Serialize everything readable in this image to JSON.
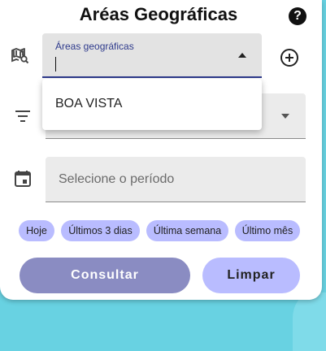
{
  "title": "Aréas Geográficas",
  "icons": {
    "help": "help-circle-icon",
    "map_search": "map-search-icon",
    "filter": "filter-icon",
    "calendar": "calendar-icon",
    "add": "add-circle-icon"
  },
  "areas_field": {
    "label": "Áreas geográficas",
    "value": ""
  },
  "dropdown": {
    "options": [
      "BOA VISTA"
    ]
  },
  "period_field": {
    "placeholder": "Selecione o período"
  },
  "chips": [
    "Hoje",
    "Últimos 3 dias",
    "Última semana",
    "Último mês"
  ],
  "buttons": {
    "consultar": "Consultar",
    "limpar": "Limpar"
  },
  "colors": {
    "accent": "#2e3a8c",
    "chip_bg": "#b9bcff",
    "primary_button": "#8a8cc2",
    "map_water": "#68d2e2"
  }
}
